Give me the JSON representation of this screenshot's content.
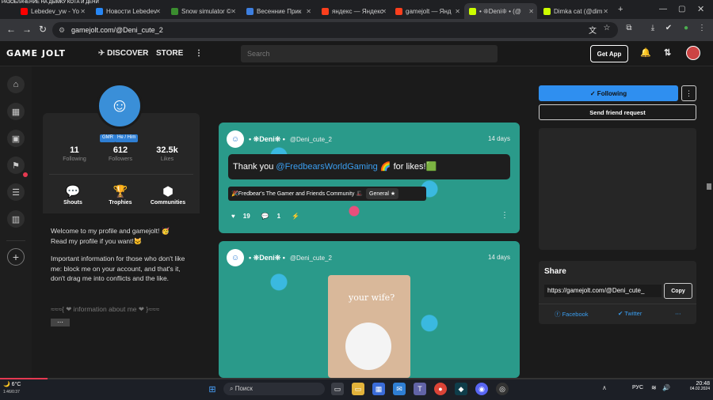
{
  "browser": {
    "overlay_caption": "РАЗОБЛАЧЕНИЕ НА ДЫМКУ КОТА И ДЕНИ",
    "tabs": [
      {
        "label": "Lebedev_yw - Yo",
        "color": "#ff0000"
      },
      {
        "label": "Новости Lebedev",
        "color": "#2787f5"
      },
      {
        "label": "Snow simulator ©",
        "color": "#3b8d2f"
      },
      {
        "label": "Весенние Прик",
        "color": "#3d7fe0"
      },
      {
        "label": "яндекс — Яндекс",
        "color": "#fc3f1d"
      },
      {
        "label": "gamejolt — Янд",
        "color": "#fc3f1d"
      },
      {
        "label": "• ❊Deni❊ • (@",
        "color": "#ccff00",
        "active": true
      },
      {
        "label": "Dimka cat (@dim",
        "color": "#ccff00"
      }
    ],
    "url": "gamejolt.com/@Deni_cute_2"
  },
  "gj_nav": {
    "logo": "GAME JOLT",
    "discover": "DISCOVER",
    "store": "STORE",
    "search_placeholder": "Search",
    "get_app": "Get App"
  },
  "profile": {
    "badges": [
      "GMR",
      "He / Him"
    ],
    "stats": [
      {
        "n": "11",
        "l": "Following"
      },
      {
        "n": "612",
        "l": "Followers"
      },
      {
        "n": "32.5k",
        "l": "Likes"
      }
    ],
    "quick": [
      {
        "ic": "💬",
        "l": "Shouts"
      },
      {
        "ic": "🏆",
        "l": "Trophies"
      },
      {
        "ic": "⬢",
        "l": "Communities"
      }
    ],
    "bio1": "Welcome to my profile and gamejolt! 🥳",
    "bio2": "Read my profile if you want!🐱",
    "bio3": "Important information for those who don't like me: block me on your account, and that's it, don't drag me into conflicts and the like.",
    "bio4": "≈≈≈{ ❤ information about me ❤ }≈≈≈",
    "more": "⋯"
  },
  "posts": [
    {
      "name": "• ❊Deni❊ •",
      "handle": "@Deni_cute_2",
      "days": "14 days",
      "pre": "Thank you ",
      "link": "@FredbearsWorldGaming",
      "post": " 🌈 for likes!🟩",
      "community": "🎉Fredbear's The Gamer and Friends Community 🎩",
      "channel": "General ★",
      "likes": "19",
      "comments": "1"
    },
    {
      "name": "• ❊Deni❊ •",
      "handle": "@Deni_cute_2",
      "days": "14 days",
      "image_text": "your wife?"
    }
  ],
  "right": {
    "following": "✓ Following",
    "friend": "Send friend request",
    "share_title": "Share",
    "share_url": "https://gamejolt.com/@Deni_cute_",
    "copy": "Copy",
    "facebook": "Facebook",
    "twitter": "Twitter"
  },
  "taskbar": {
    "weather": "6°C",
    "search": "Поиск",
    "lang": "РУС",
    "time": "20:48",
    "date": "04.02.2024",
    "video_time": "1:46/0:37"
  }
}
